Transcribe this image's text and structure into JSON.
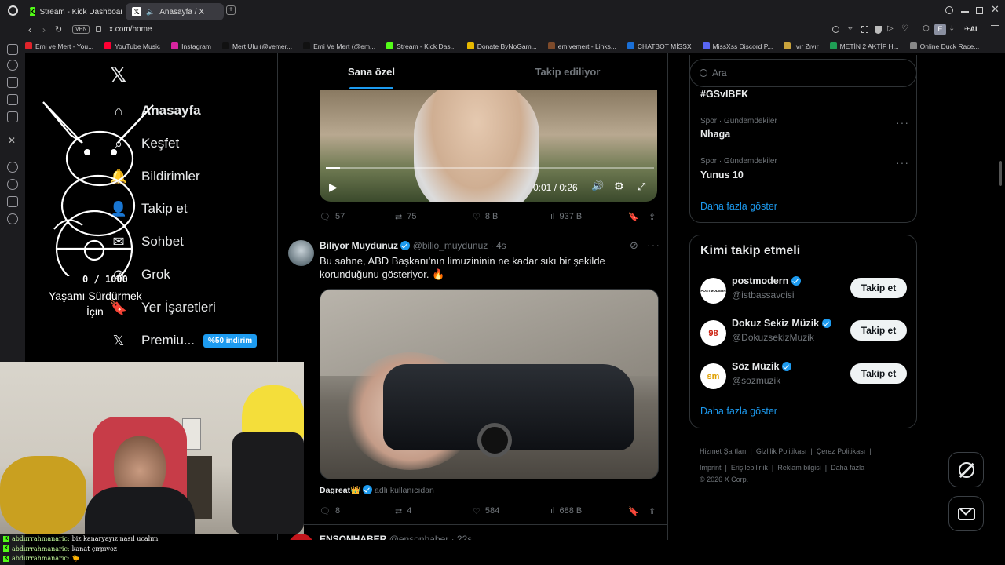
{
  "browser": {
    "tabs": [
      {
        "label": "Stream - Kick Dashboard",
        "icon": "kick-icon"
      },
      {
        "label": "Anasayfa / X",
        "icon": "x-icon"
      }
    ],
    "vpn": "VPN",
    "url": "x.com/home",
    "profile_letter": "E",
    "ai_label": "AI",
    "bookmarks": [
      "Emi ve Mert - You...",
      "YouTube Music",
      "Instagram",
      "Mert Ulu (@vemer...",
      "Emi Ve Mert (@em...",
      "Stream - Kick Das...",
      "Donate ByNoGam...",
      "emivemert - Links...",
      "CHATBOT MİSSX",
      "MissXss Discord P...",
      "Ivır Zıvır",
      "METİN 2 AKTİF H...",
      "Online Duck Race..."
    ]
  },
  "nav": {
    "items": [
      {
        "label": "Anasayfa",
        "icon": "home-icon"
      },
      {
        "label": "Keşfet",
        "icon": "search-icon"
      },
      {
        "label": "Bildirimler",
        "icon": "bell-icon"
      },
      {
        "label": "Takip et",
        "icon": "follow-icon"
      },
      {
        "label": "Sohbet",
        "icon": "chat-icon"
      },
      {
        "label": "Grok",
        "icon": "grok-icon"
      },
      {
        "label": "Yer İşaretleri",
        "icon": "bookmark-icon"
      },
      {
        "label": "Premiu...",
        "icon": "x-icon"
      }
    ],
    "premium_badge": "%50 indirim"
  },
  "overlay": {
    "counter": "0 / 1000",
    "caption_line1": "Yaşamı Sürdürmek",
    "caption_line2": "İçin"
  },
  "feed": {
    "tabs": [
      {
        "label": "Sana özel",
        "active": true
      },
      {
        "label": "Takip ediliyor",
        "active": false
      }
    ],
    "video_time": "0:01 / 0:26",
    "post1_stats": {
      "replies": "57",
      "reposts": "75",
      "likes": "8 B",
      "views": "937 B"
    },
    "post2": {
      "name": "Biliyor Muydunuz",
      "handle": "@bilio_muydunuz",
      "time": "· 4s",
      "text": "Bu sahne, ABD Başkanı'nın limuzininin ne kadar sıkı bir şekilde korunduğunu gösteriyor. 🔥",
      "media_credit_name": "Dagreat👑",
      "media_credit_suffix": "adlı kullanıcıdan",
      "stats": {
        "replies": "8",
        "reposts": "4",
        "likes": "584",
        "views": "688 B"
      }
    },
    "post3_name": "ENSONHABER",
    "post3_handle": "@ensonhaber · 22s"
  },
  "right": {
    "search_placeholder": "Ara",
    "trends": [
      {
        "category": "",
        "name": "#GSvIBFK"
      },
      {
        "category": "Spor · Gündemdekiler",
        "name": "Nhaga"
      },
      {
        "category": "Spor · Gündemdekiler",
        "name": "Yunus 10"
      }
    ],
    "show_more": "Daha fazla göster",
    "who_to_follow_title": "Kimi takip etmeli",
    "suggestions": [
      {
        "name": "postmodern",
        "handle": "@istbassavcisi",
        "avatar_text": "POSTMODERN"
      },
      {
        "name": "Dokuz Sekiz Müzik",
        "handle": "@DokuzsekizMuzik",
        "avatar_text": "98"
      },
      {
        "name": "Söz Müzik",
        "handle": "@sozmuzik",
        "avatar_text": "sm"
      }
    ],
    "follow_label": "Takip et",
    "show_more2": "Daha fazla göster",
    "footer": [
      "Hizmet Şartları",
      "Gizlilik Politikası",
      "Çerez Politikası",
      "Imprint",
      "Erişilebilirlik",
      "Reklam bilgisi",
      "Daha fazla ···",
      "© 2026 X Corp."
    ]
  },
  "chat": [
    {
      "user": "abdurrahmanaric:",
      "msg": "biz kanaryayız nasıl ucalım"
    },
    {
      "user": "abdurrahmanaric:",
      "msg": "kanat çırpıyoz"
    },
    {
      "user": "abdurrahmanaric:",
      "msg": "🐤"
    }
  ],
  "colors": {
    "accent": "#1d9bf0",
    "kick": "#53fc18",
    "background": "#000000"
  }
}
